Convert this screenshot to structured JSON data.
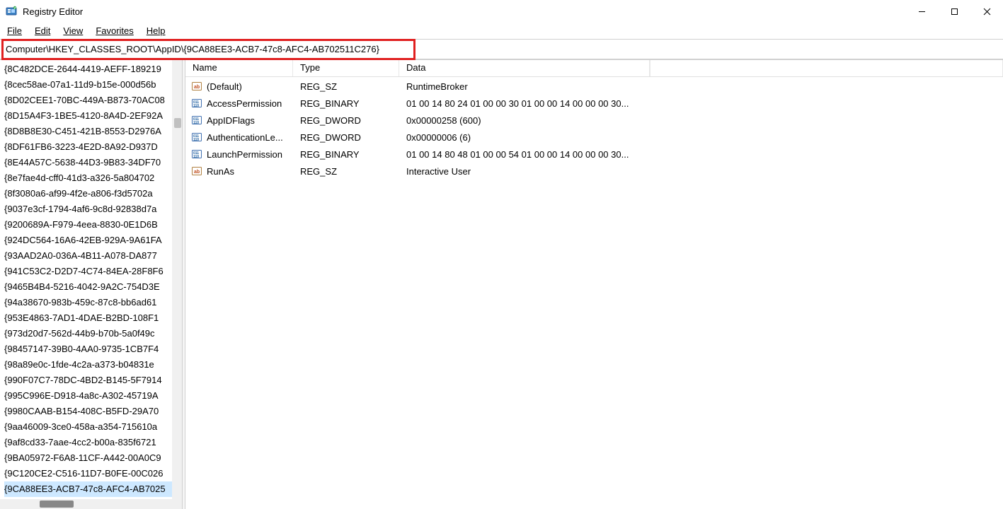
{
  "window": {
    "title": "Registry Editor"
  },
  "menu": {
    "file": "File",
    "edit": "Edit",
    "view": "View",
    "favorites": "Favorites",
    "help": "Help"
  },
  "address": {
    "path": "Computer\\HKEY_CLASSES_ROOT\\AppID\\{9CA88EE3-ACB7-47c8-AFC4-AB702511C276}"
  },
  "tree": {
    "items": [
      {
        "label": "{8C482DCE-2644-4419-AEFF-189219"
      },
      {
        "label": "{8cec58ae-07a1-11d9-b15e-000d56b"
      },
      {
        "label": "{8D02CEE1-70BC-449A-B873-70AC08"
      },
      {
        "label": "{8D15A4F3-1BE5-4120-8A4D-2EF92A"
      },
      {
        "label": "{8D8B8E30-C451-421B-8553-D2976A"
      },
      {
        "label": "{8DF61FB6-3223-4E2D-8A92-D937D"
      },
      {
        "label": "{8E44A57C-5638-44D3-9B83-34DF70"
      },
      {
        "label": "{8e7fae4d-cff0-41d3-a326-5a804702"
      },
      {
        "label": "{8f3080a6-af99-4f2e-a806-f3d5702a"
      },
      {
        "label": "{9037e3cf-1794-4af6-9c8d-92838d7a"
      },
      {
        "label": "{9200689A-F979-4eea-8830-0E1D6B"
      },
      {
        "label": "{924DC564-16A6-42EB-929A-9A61FA"
      },
      {
        "label": "{93AAD2A0-036A-4B11-A078-DA877"
      },
      {
        "label": "{941C53C2-D2D7-4C74-84EA-28F8F6"
      },
      {
        "label": "{9465B4B4-5216-4042-9A2C-754D3E"
      },
      {
        "label": "{94a38670-983b-459c-87c8-bb6ad61"
      },
      {
        "label": "{953E4863-7AD1-4DAE-B2BD-108F1"
      },
      {
        "label": "{973d20d7-562d-44b9-b70b-5a0f49c"
      },
      {
        "label": "{98457147-39B0-4AA0-9735-1CB7F4"
      },
      {
        "label": "{98a89e0c-1fde-4c2a-a373-b04831e"
      },
      {
        "label": "{990F07C7-78DC-4BD2-B145-5F7914"
      },
      {
        "label": "{995C996E-D918-4a8c-A302-45719A"
      },
      {
        "label": "{9980CAAB-B154-408C-B5FD-29A70"
      },
      {
        "label": "{9aa46009-3ce0-458a-a354-715610a"
      },
      {
        "label": "{9af8cd33-7aae-4cc2-b00a-835f6721"
      },
      {
        "label": "{9BA05972-F6A8-11CF-A442-00A0C9"
      },
      {
        "label": "{9C120CE2-C516-11D7-B0FE-00C026"
      },
      {
        "label": "{9CA88EE3-ACB7-47c8-AFC4-AB7025",
        "selected": true
      }
    ]
  },
  "columns": {
    "name": "Name",
    "type": "Type",
    "data": "Data"
  },
  "values": [
    {
      "icon": "str",
      "name": "(Default)",
      "type": "REG_SZ",
      "data": "RuntimeBroker"
    },
    {
      "icon": "bin",
      "name": "AccessPermission",
      "type": "REG_BINARY",
      "data": "01 00 14 80 24 01 00 00 30 01 00 00 14 00 00 00 30..."
    },
    {
      "icon": "bin",
      "name": "AppIDFlags",
      "type": "REG_DWORD",
      "data": "0x00000258 (600)"
    },
    {
      "icon": "bin",
      "name": "AuthenticationLe...",
      "type": "REG_DWORD",
      "data": "0x00000006 (6)"
    },
    {
      "icon": "bin",
      "name": "LaunchPermission",
      "type": "REG_BINARY",
      "data": "01 00 14 80 48 01 00 00 54 01 00 00 14 00 00 00 30..."
    },
    {
      "icon": "str",
      "name": "RunAs",
      "type": "REG_SZ",
      "data": "Interactive User"
    }
  ]
}
